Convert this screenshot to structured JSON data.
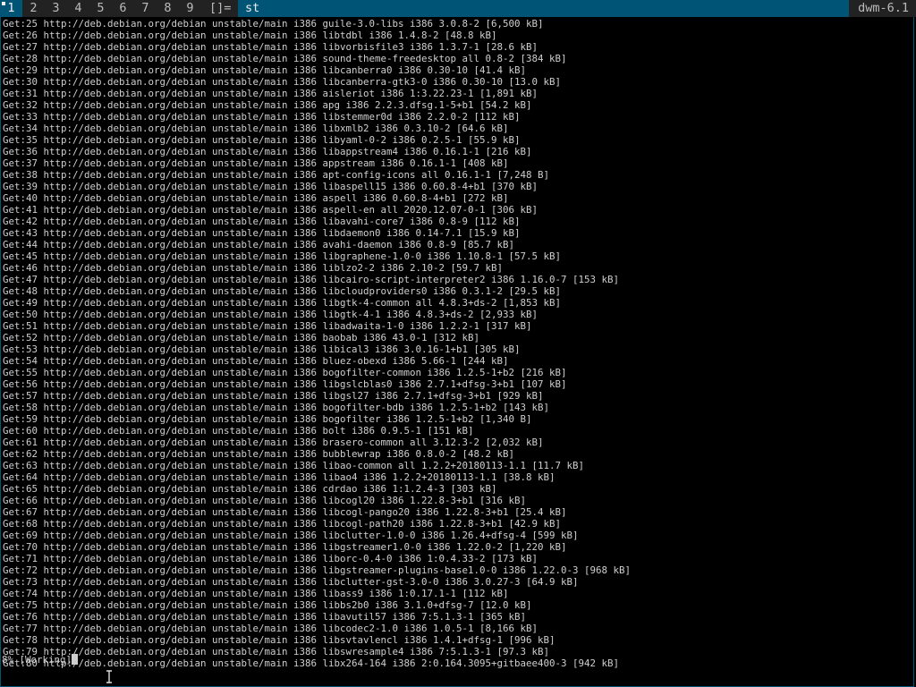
{
  "dwm_bar": {
    "tags": [
      "1",
      "2",
      "3",
      "4",
      "5",
      "6",
      "7",
      "8",
      "9"
    ],
    "selected_tag": "1",
    "layout_symbol": "[]=",
    "window_title": "st",
    "status_text": "dwm-6.1",
    "colors": {
      "bar_bg": "#222222",
      "bar_fg": "#bbbbbb",
      "selected_bg": "#005577",
      "selected_fg": "#eeeeee"
    }
  },
  "terminal": {
    "lines": [
      "Get:25 http://deb.debian.org/debian unstable/main i386 guile-3.0-libs i386 3.0.8-2 [6,500 kB]",
      "Get:26 http://deb.debian.org/debian unstable/main i386 libtdbl i386 1.4.8-2 [48.8 kB]",
      "Get:27 http://deb.debian.org/debian unstable/main i386 libvorbisfile3 i386 1.3.7-1 [28.6 kB]",
      "Get:28 http://deb.debian.org/debian unstable/main i386 sound-theme-freedesktop all 0.8-2 [384 kB]",
      "Get:29 http://deb.debian.org/debian unstable/main i386 libcanberra0 i386 0.30-10 [41.4 kB]",
      "Get:30 http://deb.debian.org/debian unstable/main i386 libcanberra-gtk3-0 i386 0.30-10 [13.0 kB]",
      "Get:31 http://deb.debian.org/debian unstable/main i386 aisleriot i386 1:3.22.23-1 [1,891 kB]",
      "Get:32 http://deb.debian.org/debian unstable/main i386 apg i386 2.2.3.dfsg.1-5+b1 [54.2 kB]",
      "Get:33 http://deb.debian.org/debian unstable/main i386 libstemmer0d i386 2.2.0-2 [112 kB]",
      "Get:34 http://deb.debian.org/debian unstable/main i386 libxmlb2 i386 0.3.10-2 [64.6 kB]",
      "Get:35 http://deb.debian.org/debian unstable/main i386 libyaml-0-2 i386 0.2.5-1 [55.9 kB]",
      "Get:36 http://deb.debian.org/debian unstable/main i386 libappstream4 i386 0.16.1-1 [216 kB]",
      "Get:37 http://deb.debian.org/debian unstable/main i386 appstream i386 0.16.1-1 [408 kB]",
      "Get:38 http://deb.debian.org/debian unstable/main i386 apt-config-icons all 0.16.1-1 [7,248 B]",
      "Get:39 http://deb.debian.org/debian unstable/main i386 libaspell15 i386 0.60.8-4+b1 [370 kB]",
      "Get:40 http://deb.debian.org/debian unstable/main i386 aspell i386 0.60.8-4+b1 [272 kB]",
      "Get:41 http://deb.debian.org/debian unstable/main i386 aspell-en all 2020.12.07-0-1 [306 kB]",
      "Get:42 http://deb.debian.org/debian unstable/main i386 libavahi-core7 i386 0.8-9 [112 kB]",
      "Get:43 http://deb.debian.org/debian unstable/main i386 libdaemon0 i386 0.14-7.1 [15.9 kB]",
      "Get:44 http://deb.debian.org/debian unstable/main i386 avahi-daemon i386 0.8-9 [85.7 kB]",
      "Get:45 http://deb.debian.org/debian unstable/main i386 libgraphene-1.0-0 i386 1.10.8-1 [57.5 kB]",
      "Get:46 http://deb.debian.org/debian unstable/main i386 liblzo2-2 i386 2.10-2 [59.7 kB]",
      "Get:47 http://deb.debian.org/debian unstable/main i386 libcairo-script-interpreter2 i386 1.16.0-7 [153 kB]",
      "Get:48 http://deb.debian.org/debian unstable/main i386 libcloudproviders0 i386 0.3.1-2 [29.5 kB]",
      "Get:49 http://deb.debian.org/debian unstable/main i386 libgtk-4-common all 4.8.3+ds-2 [1,853 kB]",
      "Get:50 http://deb.debian.org/debian unstable/main i386 libgtk-4-1 i386 4.8.3+ds-2 [2,933 kB]",
      "Get:51 http://deb.debian.org/debian unstable/main i386 libadwaita-1-0 i386 1.2.2-1 [317 kB]",
      "Get:52 http://deb.debian.org/debian unstable/main i386 baobab i386 43.0-1 [312 kB]",
      "Get:53 http://deb.debian.org/debian unstable/main i386 libical3 i386 3.0.16-1+b1 [305 kB]",
      "Get:54 http://deb.debian.org/debian unstable/main i386 bluez-obexd i386 5.66-1 [244 kB]",
      "Get:55 http://deb.debian.org/debian unstable/main i386 bogofilter-common i386 1.2.5-1+b2 [216 kB]",
      "Get:56 http://deb.debian.org/debian unstable/main i386 libgslcblas0 i386 2.7.1+dfsg-3+b1 [107 kB]",
      "Get:57 http://deb.debian.org/debian unstable/main i386 libgsl27 i386 2.7.1+dfsg-3+b1 [929 kB]",
      "Get:58 http://deb.debian.org/debian unstable/main i386 bogofilter-bdb i386 1.2.5-1+b2 [143 kB]",
      "Get:59 http://deb.debian.org/debian unstable/main i386 bogofilter i386 1.2.5-1+b2 [1,340 B]",
      "Get:60 http://deb.debian.org/debian unstable/main i386 bolt i386 0.9.5-1 [151 kB]",
      "Get:61 http://deb.debian.org/debian unstable/main i386 brasero-common all 3.12.3-2 [2,032 kB]",
      "Get:62 http://deb.debian.org/debian unstable/main i386 bubblewrap i386 0.8.0-2 [48.2 kB]",
      "Get:63 http://deb.debian.org/debian unstable/main i386 libao-common all 1.2.2+20180113-1.1 [11.7 kB]",
      "Get:64 http://deb.debian.org/debian unstable/main i386 libao4 i386 1.2.2+20180113-1.1 [38.8 kB]",
      "Get:65 http://deb.debian.org/debian unstable/main i386 cdrdao i386 1:1.2.4-3 [303 kB]",
      "Get:66 http://deb.debian.org/debian unstable/main i386 libcogl20 i386 1.22.8-3+b1 [316 kB]",
      "Get:67 http://deb.debian.org/debian unstable/main i386 libcogl-pango20 i386 1.22.8-3+b1 [25.4 kB]",
      "Get:68 http://deb.debian.org/debian unstable/main i386 libcogl-path20 i386 1.22.8-3+b1 [42.9 kB]",
      "Get:69 http://deb.debian.org/debian unstable/main i386 libclutter-1.0-0 i386 1.26.4+dfsg-4 [599 kB]",
      "Get:70 http://deb.debian.org/debian unstable/main i386 libgstreamer1.0-0 i386 1.22.0-2 [1,220 kB]",
      "Get:71 http://deb.debian.org/debian unstable/main i386 liborc-0.4-0 i386 1:0.4.33-2 [173 kB]",
      "Get:72 http://deb.debian.org/debian unstable/main i386 libgstreamer-plugins-base1.0-0 i386 1.22.0-3 [968 kB]",
      "Get:73 http://deb.debian.org/debian unstable/main i386 libclutter-gst-3.0-0 i386 3.0.27-3 [64.9 kB]",
      "Get:74 http://deb.debian.org/debian unstable/main i386 libass9 i386 1:0.17.1-1 [112 kB]",
      "Get:75 http://deb.debian.org/debian unstable/main i386 libbs2b0 i386 3.1.0+dfsg-7 [12.0 kB]",
      "Get:76 http://deb.debian.org/debian unstable/main i386 libavutil57 i386 7:5.1.3-1 [365 kB]",
      "Get:77 http://deb.debian.org/debian unstable/main i386 libcodec2-1.0 i386 1.0.5-1 [8,166 kB]",
      "Get:78 http://deb.debian.org/debian unstable/main i386 libsvtavlencl i386 1.4.1+dfsg-1 [996 kB]",
      "Get:79 http://deb.debian.org/debian unstable/main i386 libswresample4 i386 7:5.1.3-1 [97.3 kB]",
      "Get:80 http://deb.debian.org/debian unstable/main i386 libx264-164 i386 2:0.164.3095+gitbaee400-3 [942 kB]"
    ],
    "prompt_text": "8% [Working]"
  }
}
